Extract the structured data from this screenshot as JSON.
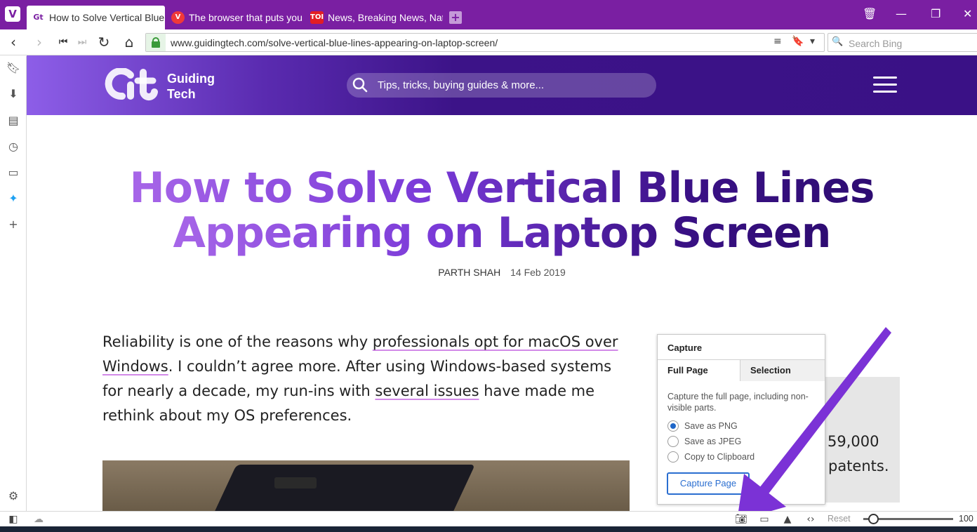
{
  "browser": {
    "accent": "#7a1fa2",
    "tabs": [
      {
        "label": "How to Solve Vertical Blue L",
        "favicon": "gt-logo",
        "active": true
      },
      {
        "label": "The browser that puts you i",
        "favicon": "vivaldi-logo",
        "active": false
      },
      {
        "label": "News, Breaking News, Natio",
        "favicon": "TOI",
        "active": false
      }
    ],
    "url": "www.guidingtech.com/solve-vertical-blue-lines-appearing-on-laptop-screen/",
    "search_placeholder": "Search Bing",
    "side_panel_icons": [
      "bookmark-icon",
      "download-icon",
      "notes-icon",
      "history-icon",
      "window-icon",
      "twitter-icon",
      "add-panel-icon",
      "settings-icon"
    ]
  },
  "site": {
    "logo_line1": "Guiding",
    "logo_line2": "Tech",
    "search_placeholder": "Tips, tricks, buying guides & more..."
  },
  "article": {
    "headline_line1": "How to Solve Vertical Blue Lines",
    "headline_line2": "Appearing on Laptop Screen",
    "author": "PARTH SHAH",
    "date": "14 Feb 2019",
    "para_1": "Reliability is one of the reasons why ",
    "link_1": "professionals opt for macOS over Windows",
    "para_2": ". I couldn’t agree more. After using Windows-based systems for nearly a decade, my run-ins with ",
    "link_2": "several issues",
    "para_3": " have made me rethink about my OS preferences."
  },
  "aside": {
    "line1": "59,000",
    "line2": "patents."
  },
  "capture_popup": {
    "title": "Capture",
    "tab_full": "Full Page",
    "tab_selection": "Selection",
    "description": "Capture the full page, including non-visible parts.",
    "options": [
      {
        "label": "Save as PNG",
        "selected": true
      },
      {
        "label": "Save as JPEG",
        "selected": false
      },
      {
        "label": "Copy to Clipboard",
        "selected": false
      }
    ],
    "button": "Capture Page"
  },
  "statusbar": {
    "reset": "Reset",
    "zoom": "100"
  }
}
